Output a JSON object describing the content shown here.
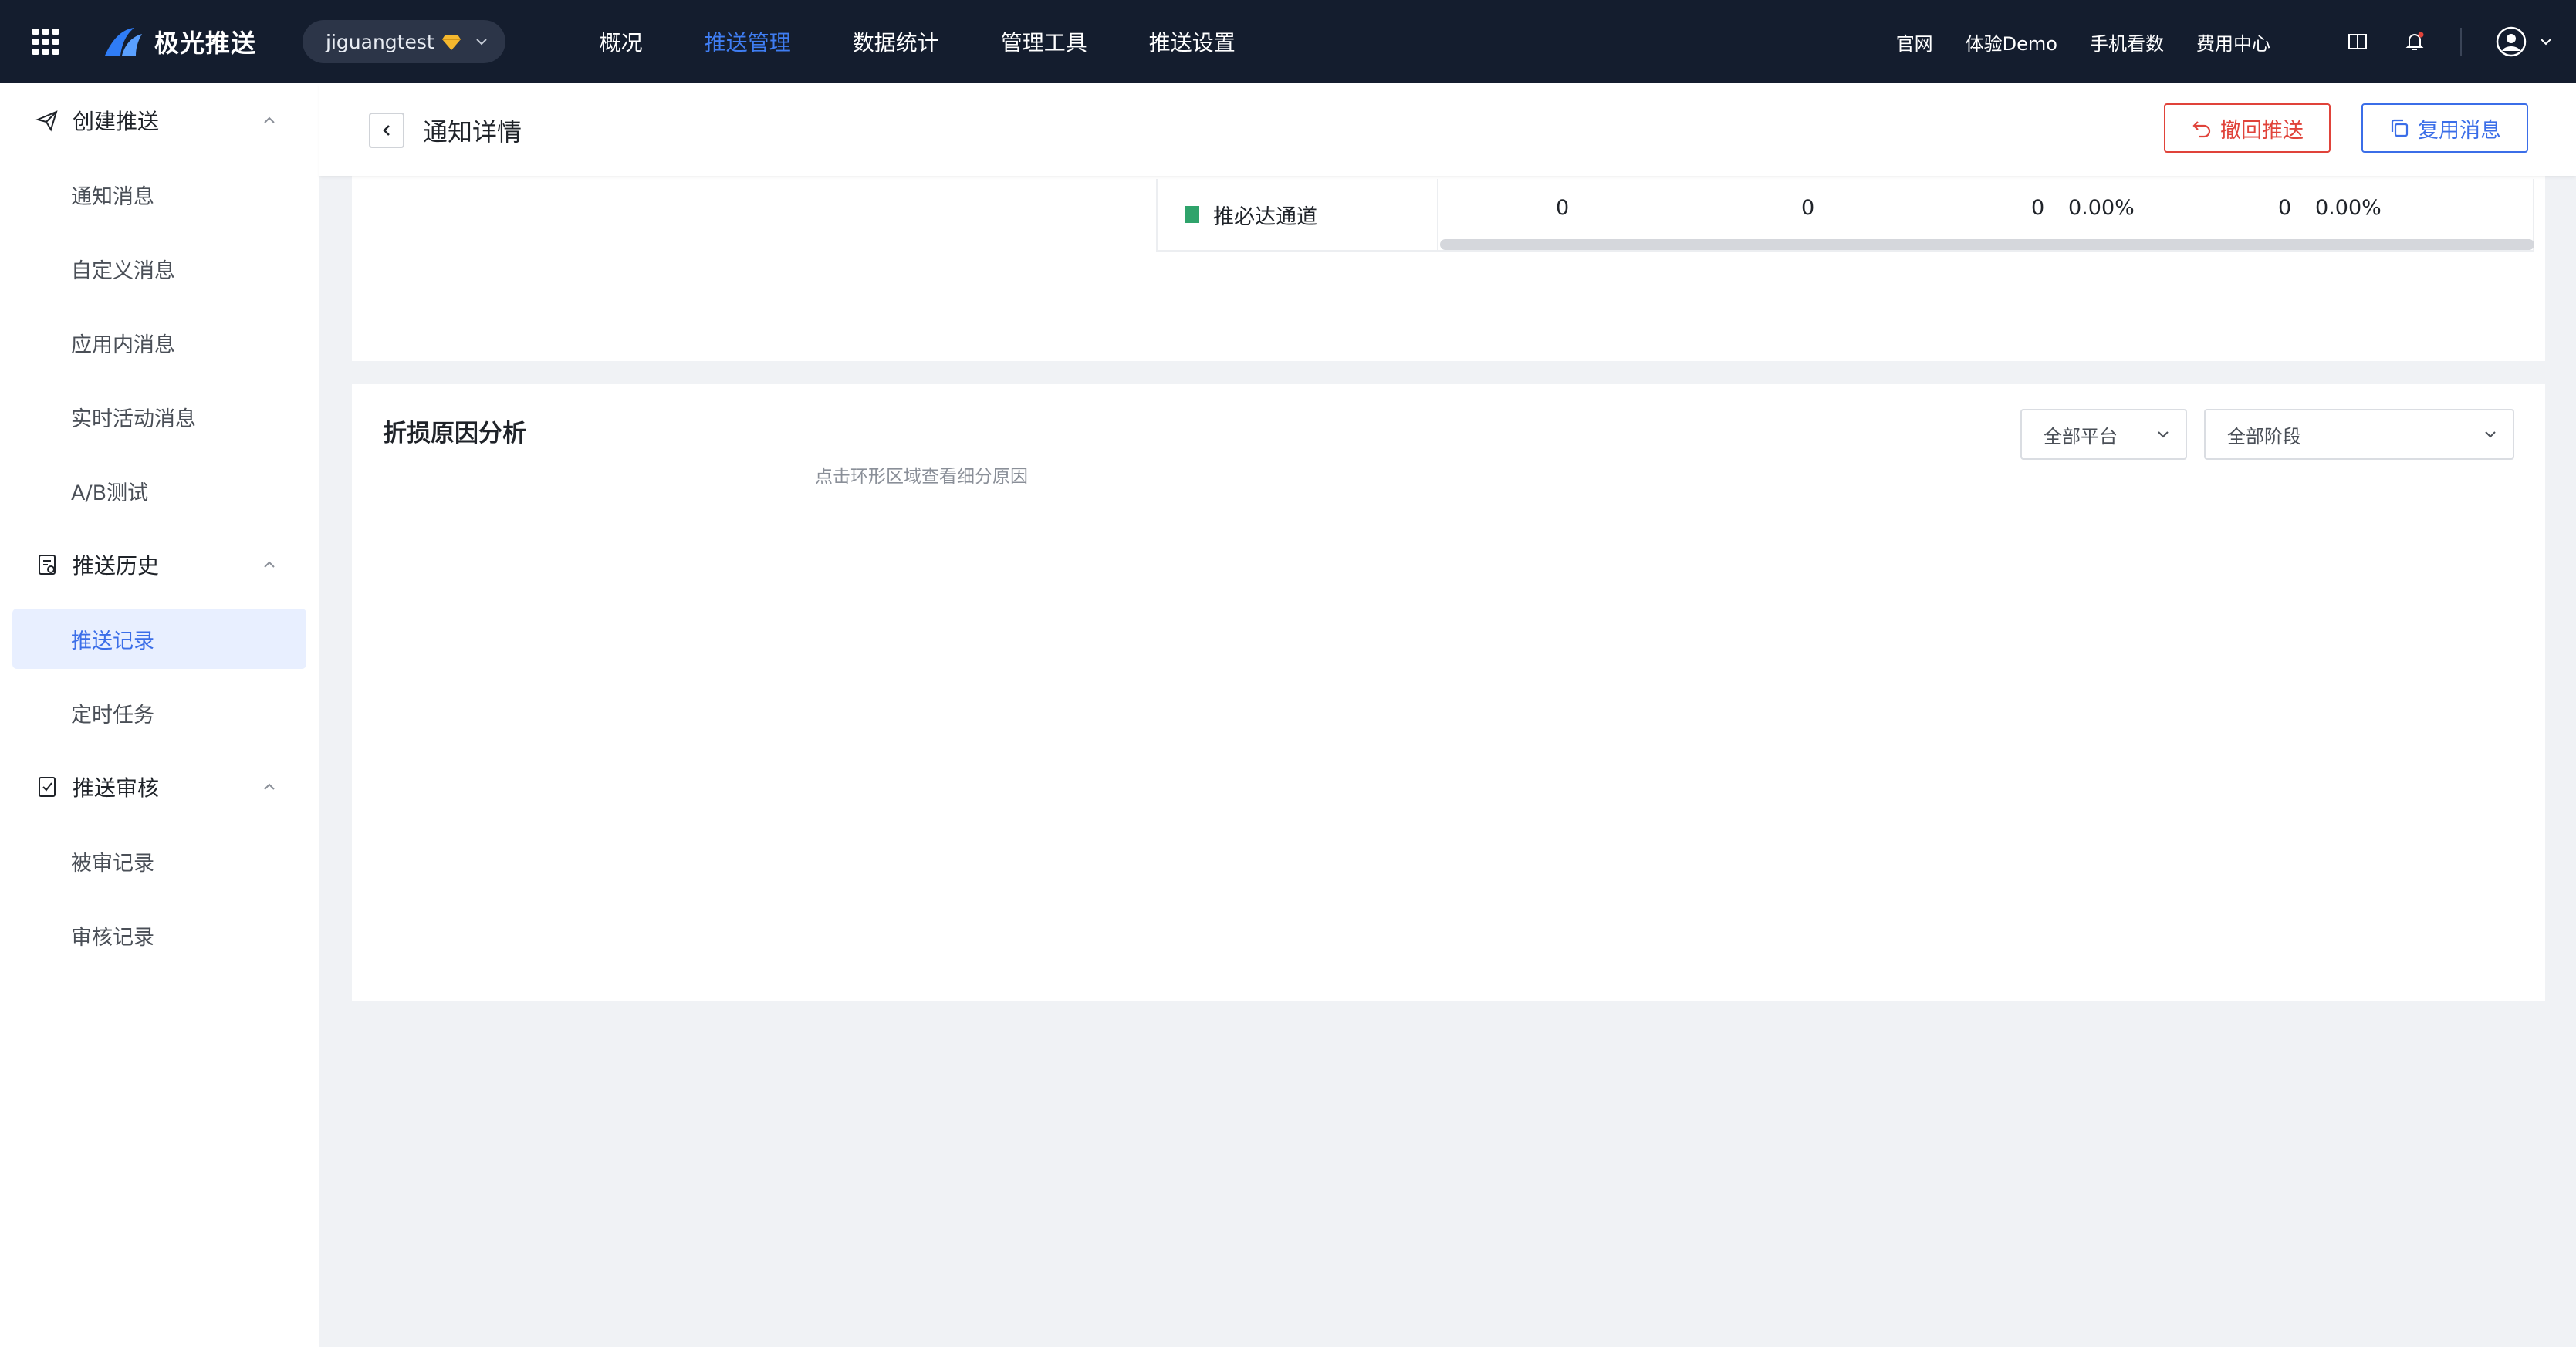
{
  "topbar": {
    "brand": "极光推送",
    "account": "jiguangtest",
    "nav": [
      {
        "label": "概况",
        "active": false
      },
      {
        "label": "推送管理",
        "active": true
      },
      {
        "label": "数据统计",
        "active": false
      },
      {
        "label": "管理工具",
        "active": false
      },
      {
        "label": "推送设置",
        "active": false
      }
    ],
    "links": [
      "官网",
      "体验Demo",
      "手机看数",
      "费用中心"
    ]
  },
  "sidebar": {
    "groups": [
      {
        "label": "创建推送",
        "items": [
          "通知消息",
          "自定义消息",
          "应用内消息",
          "实时活动消息",
          "A/B测试"
        ]
      },
      {
        "label": "推送历史",
        "items": [
          "推送记录",
          "定时任务"
        ],
        "active_item": "推送记录"
      },
      {
        "label": "推送审核",
        "items": [
          "被审记录",
          "审核记录"
        ]
      }
    ]
  },
  "header": {
    "title": "通知详情",
    "recall_label": "撤回推送",
    "reuse_label": "复用消息"
  },
  "channel_row": {
    "label": "推必达通道",
    "values": [
      "0",
      "0",
      "0",
      "0.00%",
      "0",
      "0.00%"
    ],
    "colors": {
      "channel": "#2fa36b"
    }
  },
  "loss": {
    "title": "折损原因分析",
    "platform_select": "全部平台",
    "stage_select": "全部阶段",
    "hint": "点击环形区域查看细分原因"
  },
  "colors": {
    "accent": "#3b6ee8",
    "topbar_bg": "#141d2e",
    "danger": "#e0433a"
  }
}
